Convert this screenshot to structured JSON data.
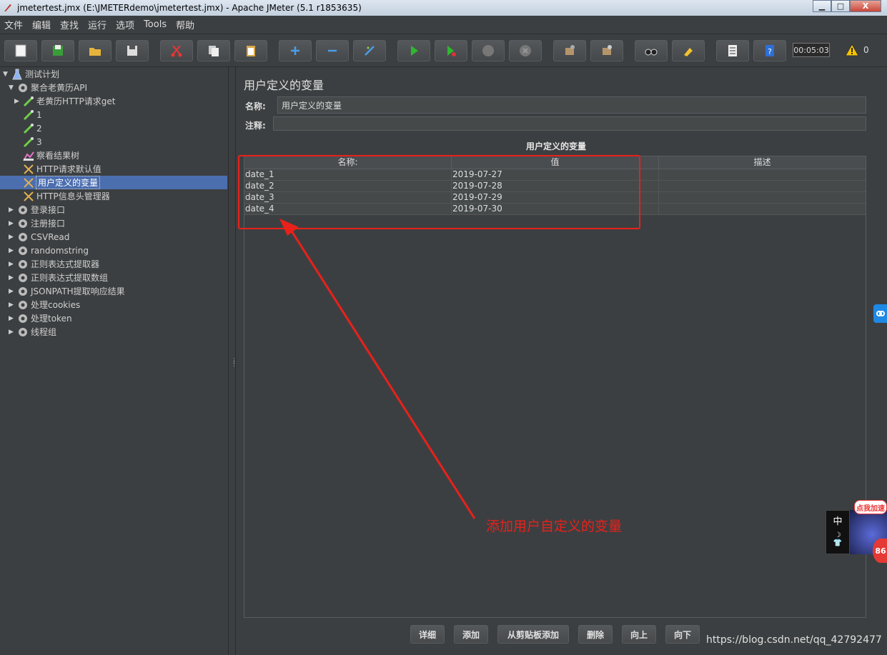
{
  "window": {
    "title": "jmetertest.jmx (E:\\JMETERdemo\\jmetertest.jmx) - Apache JMeter (5.1 r1853635)",
    "minimize": "▁",
    "maximize": "□",
    "close": "X"
  },
  "menu": [
    "文件",
    "编辑",
    "查找",
    "运行",
    "选项",
    "Tools",
    "帮助"
  ],
  "toolbar": {
    "timer": "00:05:03",
    "warning_count": "0"
  },
  "tree": {
    "items": [
      {
        "label": "测试计划",
        "icon": "flask-icon"
      },
      {
        "label": "聚合老黄历API",
        "icon": "gear-icon"
      },
      {
        "label": "老黄历HTTP请求get",
        "icon": "pipette-icon"
      },
      {
        "label": "1",
        "icon": "pipette-icon"
      },
      {
        "label": "2",
        "icon": "pipette-icon"
      },
      {
        "label": "3",
        "icon": "pipette-icon"
      },
      {
        "label": "察看结果树",
        "icon": "chart-icon"
      },
      {
        "label": "HTTP请求默认值",
        "icon": "wrench-icon"
      },
      {
        "label": "用户定义的变量",
        "icon": "wrench-icon"
      },
      {
        "label": "HTTP信息头管理器",
        "icon": "wrench-icon"
      },
      {
        "label": "登录接口",
        "icon": "gear-icon"
      },
      {
        "label": "注册接口",
        "icon": "gear-icon"
      },
      {
        "label": "CSVRead",
        "icon": "gear-icon"
      },
      {
        "label": "randomstring",
        "icon": "gear-icon"
      },
      {
        "label": "正则表达式提取器",
        "icon": "gear-icon"
      },
      {
        "label": "正则表达式提取数组",
        "icon": "gear-icon"
      },
      {
        "label": "JSONPATH提取响应结果",
        "icon": "gear-icon"
      },
      {
        "label": "处理cookies",
        "icon": "gear-icon"
      },
      {
        "label": "处理token",
        "icon": "gear-icon"
      },
      {
        "label": "线程组",
        "icon": "gear-icon"
      }
    ]
  },
  "panel": {
    "title": "用户定义的变量",
    "name_label": "名称:",
    "name_value": "用户定义的变量",
    "comment_label": "注释:",
    "comment_value": "",
    "table_caption": "用户定义的变量",
    "columns": [
      "名称:",
      "值",
      "描述"
    ],
    "rows": [
      [
        "date_1",
        "2019-07-27",
        ""
      ],
      [
        "date_2",
        "2019-07-28",
        ""
      ],
      [
        "date_3",
        "2019-07-29",
        ""
      ],
      [
        "date_4",
        "2019-07-30",
        ""
      ]
    ]
  },
  "buttons": [
    "详细",
    "添加",
    "从剪贴板添加",
    "删除",
    "向上",
    "向下"
  ],
  "annotation": {
    "text": "添加用户自定义的变量",
    "color": "#e8211b"
  },
  "watermark": "https://blog.csdn.net/qq_42792477",
  "widget": {
    "badge": "点我加速",
    "char": "中",
    "count": "86"
  },
  "colors": {
    "background": "#3c3f41",
    "selection": "#4b6eaf"
  }
}
